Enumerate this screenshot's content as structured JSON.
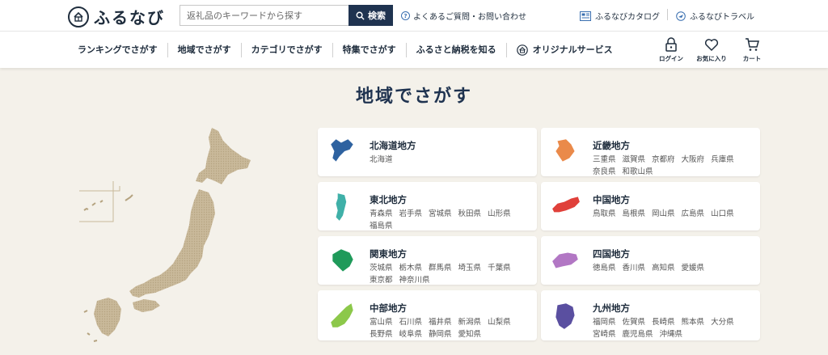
{
  "header": {
    "logo_text": "ふるなび",
    "search_placeholder": "返礼品のキーワードから探す",
    "search_button": "検索",
    "faq_link": "よくあるご質問・お問い合わせ",
    "catalog_link": "ふるなびカタログ",
    "travel_link": "ふるなびトラベル"
  },
  "nav": {
    "items": [
      "ランキングでさがす",
      "地域でさがす",
      "カテゴリでさがす",
      "特集でさがす",
      "ふるさと納税を知る",
      "オリジナルサービス"
    ],
    "login": "ログイン",
    "favorites": "お気に入り",
    "cart": "カート"
  },
  "main": {
    "title": "地域でさがす"
  },
  "regions": [
    {
      "name": "北海道地方",
      "prefectures": [
        "北海道"
      ],
      "color": "#2e62a0",
      "icon": "hokkaido-map-icon"
    },
    {
      "name": "近畿地方",
      "prefectures": [
        "三重県",
        "滋賀県",
        "京都府",
        "大阪府",
        "兵庫県",
        "奈良県",
        "和歌山県"
      ],
      "color": "#ea8a4a",
      "icon": "kinki-map-icon"
    },
    {
      "name": "東北地方",
      "prefectures": [
        "青森県",
        "岩手県",
        "宮城県",
        "秋田県",
        "山形県",
        "福島県"
      ],
      "color": "#3fb0a8",
      "icon": "tohoku-map-icon"
    },
    {
      "name": "中国地方",
      "prefectures": [
        "鳥取県",
        "島根県",
        "岡山県",
        "広島県",
        "山口県"
      ],
      "color": "#e0403a",
      "icon": "chugoku-map-icon"
    },
    {
      "name": "関東地方",
      "prefectures": [
        "茨城県",
        "栃木県",
        "群馬県",
        "埼玉県",
        "千葉県",
        "東京都",
        "神奈川県"
      ],
      "color": "#1f9a5a",
      "icon": "kanto-map-icon"
    },
    {
      "name": "四国地方",
      "prefectures": [
        "徳島県",
        "香川県",
        "高知県",
        "愛媛県"
      ],
      "color": "#b277c4",
      "icon": "shikoku-map-icon"
    },
    {
      "name": "中部地方",
      "prefectures": [
        "富山県",
        "石川県",
        "福井県",
        "新潟県",
        "山梨県",
        "長野県",
        "岐阜県",
        "静岡県",
        "愛知県"
      ],
      "color": "#8cc84a",
      "icon": "chubu-map-icon"
    },
    {
      "name": "九州地方",
      "prefectures": [
        "福岡県",
        "佐賀県",
        "長崎県",
        "熊本県",
        "大分県",
        "宮崎県",
        "鹿児島県",
        "沖縄県"
      ],
      "color": "#5a4fa0",
      "icon": "kyushu-map-icon"
    }
  ]
}
